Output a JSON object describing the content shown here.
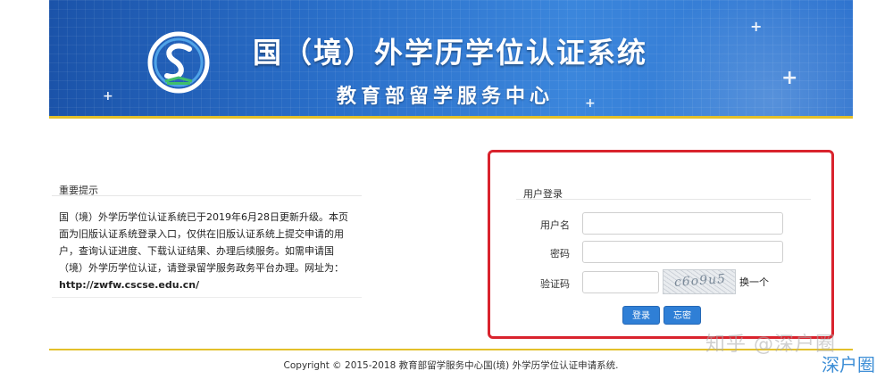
{
  "banner": {
    "title": "国（境）外学历学位认证系统",
    "subtitle": "教育部留学服务中心"
  },
  "notice": {
    "title": "重要提示",
    "body": "国（境）外学历学位认证系统已于2019年6月28日更新升级。本页面为旧版认证系统登录入口，仅供在旧版认证系统上提交申请的用户，查询认证进度、下载认证结果、办理后续服务。如需申请国（境）外学历学位认证，请登录留学服务政务平台办理。网址为：",
    "url": "http://zwfw.cscse.edu.cn/"
  },
  "login": {
    "title": "用户登录",
    "username_label": "用户名",
    "password_label": "密码",
    "captcha_label": "验证码",
    "captcha_text": "c6o9u5",
    "refresh_label": "换一个",
    "login_button": "登录",
    "forgot_button": "忘密",
    "username_value": "",
    "password_value": "",
    "captcha_value": ""
  },
  "footer": {
    "copyright": "Copyright © 2015-2018 教育部留学服务中心国(境) 外学历学位认证申请系统."
  },
  "watermark": {
    "line1": "知乎 @深户圈",
    "line2": "深户圈"
  },
  "colors": {
    "banner_blue": "#2a6fc9",
    "accent_gold": "#e3c02a",
    "button_blue": "#2f7fd6",
    "highlight_red": "#d9232d"
  }
}
